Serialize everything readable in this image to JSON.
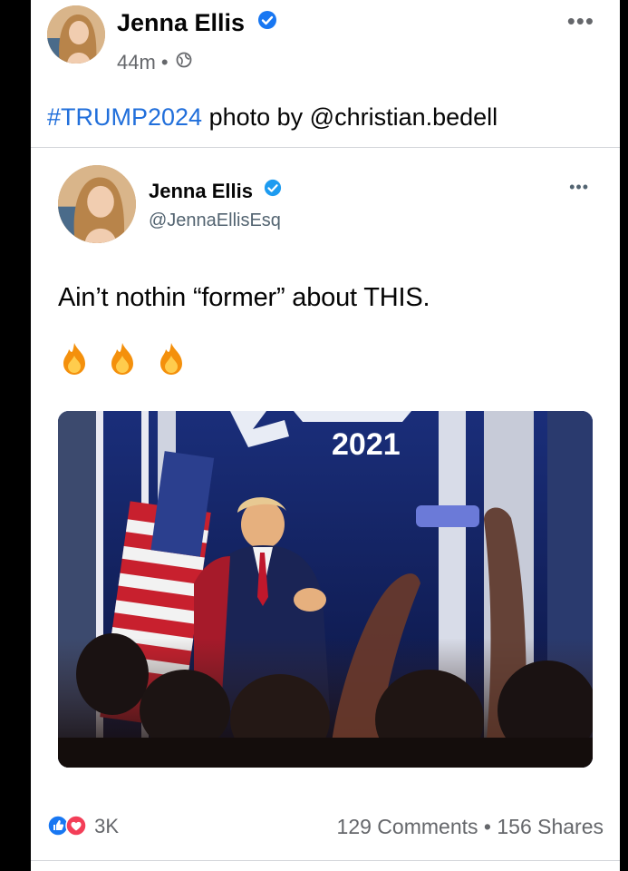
{
  "post": {
    "author": "Jenna Ellis",
    "time": "44m",
    "time_sep": "•",
    "caption_tag": "#TRUMP2024",
    "caption_rest": " photo by @christian.bedell",
    "more_label": "•••",
    "icons": {
      "verified": "verified-badge-icon",
      "privacy": "globe-icon",
      "more": "more-options-icon"
    },
    "colors": {
      "hashtag": "#216fdb",
      "verified": "#1877f2"
    }
  },
  "tweet": {
    "name": "Jenna Ellis",
    "handle": "@JennaEllisEsq",
    "text": "Ain’t nothin “former” about THIS.",
    "emoji": "🔥🔥🔥",
    "more_label": "•••",
    "photo_text": "2021"
  },
  "footer": {
    "reaction_count": "3K",
    "reaction_icons": [
      "like-icon",
      "love-icon"
    ],
    "comments": "129 Comments",
    "shares": "156 Shares",
    "sep": "•"
  }
}
